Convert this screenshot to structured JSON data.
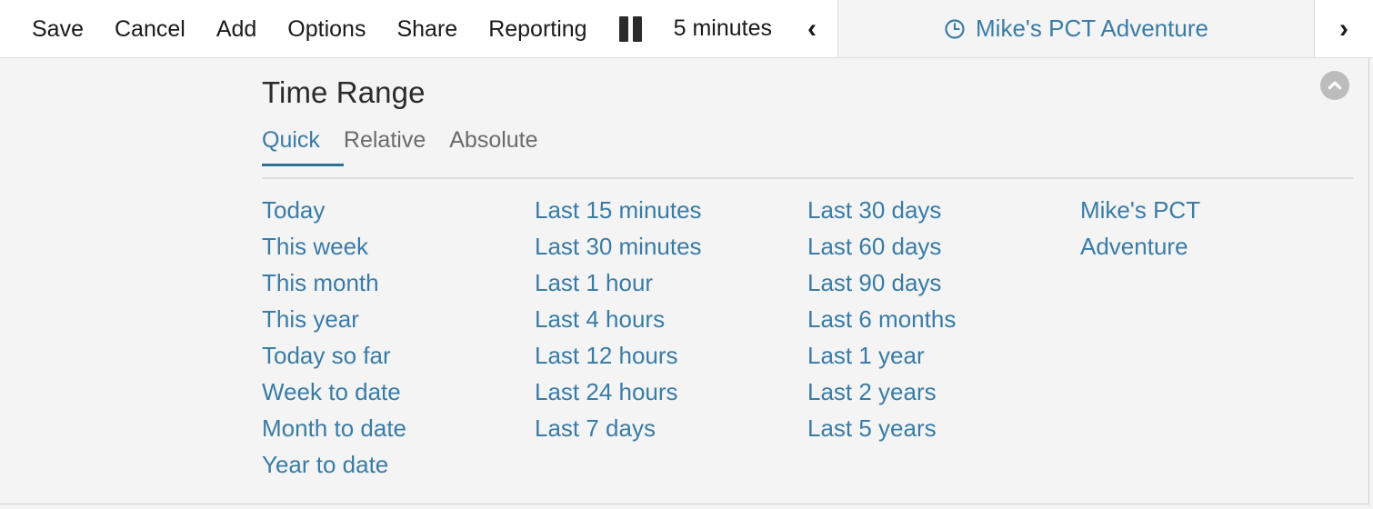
{
  "toolbar": {
    "actions": [
      {
        "label": "Save",
        "name": "save-button"
      },
      {
        "label": "Cancel",
        "name": "cancel-button"
      },
      {
        "label": "Add",
        "name": "add-button"
      },
      {
        "label": "Options",
        "name": "options-button"
      },
      {
        "label": "Share",
        "name": "share-button"
      },
      {
        "label": "Reporting",
        "name": "reporting-button"
      }
    ],
    "pause_icon": "pause-icon",
    "refresh_interval": "5 minutes",
    "prev_icon": "chevron-left-icon",
    "next_icon": "chevron-right-icon",
    "prev_glyph": "‹",
    "next_glyph": "›",
    "active_tab": {
      "icon": "clock-icon",
      "label": "Mike's PCT Adventure"
    }
  },
  "panel": {
    "title": "Time Range",
    "collapse_icon": "chevron-up-icon",
    "tabs": [
      {
        "label": "Quick",
        "active": true
      },
      {
        "label": "Relative",
        "active": false
      },
      {
        "label": "Absolute",
        "active": false
      }
    ],
    "quick_columns": [
      {
        "items": [
          "Today",
          "This week",
          "This month",
          "This year",
          "Today so far",
          "Week to date",
          "Month to date",
          "Year to date"
        ]
      },
      {
        "items": [
          "Last 15 minutes",
          "Last 30 minutes",
          "Last 1 hour",
          "Last 4 hours",
          "Last 12 hours",
          "Last 24 hours",
          "Last 7 days"
        ]
      },
      {
        "items": [
          "Last 30 days",
          "Last 60 days",
          "Last 90 days",
          "Last 6 months",
          "Last 1 year",
          "Last 2 years",
          "Last 5 years"
        ]
      },
      {
        "items": [
          "Mike's PCT Adventure"
        ]
      }
    ]
  },
  "colors": {
    "link": "#3a7ca5",
    "tab_underline": "#2f7297",
    "panel_bg": "#f4f4f4",
    "toolbar_bg": "#ffffff",
    "text": "#1a1a1a",
    "muted_text": "#6b6b6b",
    "border": "#dcdcdc",
    "collapse_bg": "#bcbcbc"
  }
}
